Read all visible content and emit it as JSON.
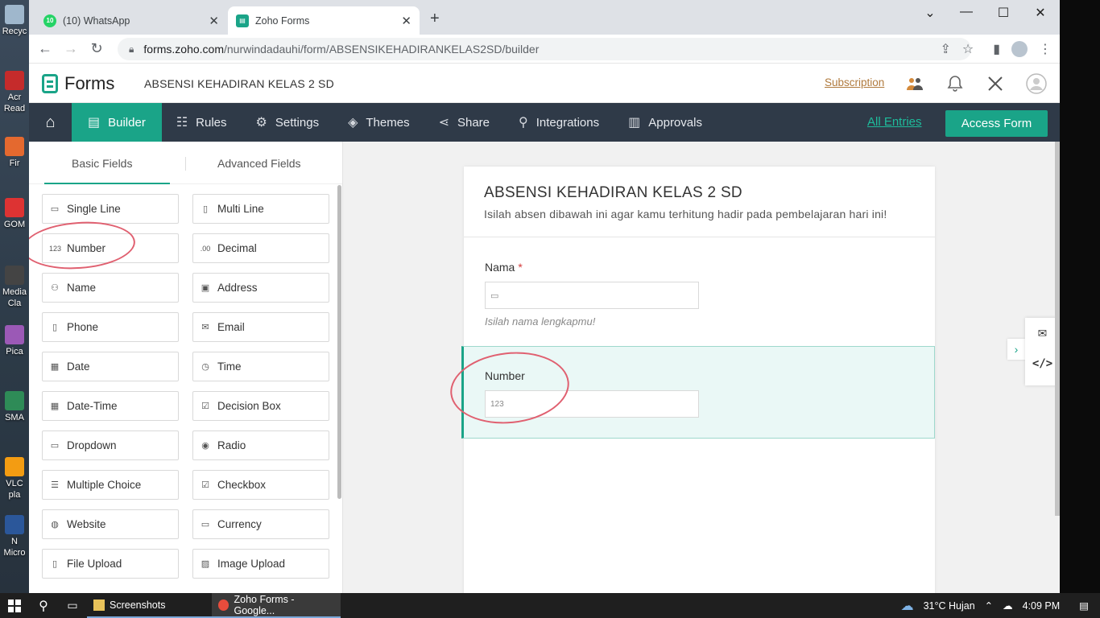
{
  "desktop": {
    "icons": [
      "Recyc",
      "Acr\nRead",
      "Fir",
      "GOM",
      "Media\nCla",
      "Pica",
      "SMA",
      "VLC\npla",
      "N\nMicro"
    ]
  },
  "browser": {
    "tabs": [
      {
        "label": "(10) WhatsApp",
        "badge": "10",
        "color": "#25d366"
      },
      {
        "label": "Zoho Forms",
        "color": "#1aa488"
      }
    ],
    "url_host": "forms.zoho.com",
    "url_path": "/nurwindadauhi/form/ABSENSIKEHADIRANKELAS2SD/builder"
  },
  "header": {
    "app_name": "Forms",
    "form_title": "ABSENSI KEHADIRAN KELAS 2 SD",
    "subscription": "Subscription"
  },
  "nav": {
    "items": [
      {
        "label": "Builder",
        "icon": "builder-icon"
      },
      {
        "label": "Rules",
        "icon": "rules-icon"
      },
      {
        "label": "Settings",
        "icon": "settings-icon"
      },
      {
        "label": "Themes",
        "icon": "themes-icon"
      },
      {
        "label": "Share",
        "icon": "share-icon"
      },
      {
        "label": "Integrations",
        "icon": "integrations-icon"
      },
      {
        "label": "Approvals",
        "icon": "approvals-icon"
      }
    ],
    "all_entries": "All Entries",
    "access_form": "Access Form"
  },
  "panel": {
    "tabs": [
      "Basic Fields",
      "Advanced Fields"
    ],
    "fields": [
      [
        "Single Line",
        "Multi Line"
      ],
      [
        "Number",
        "Decimal"
      ],
      [
        "Name",
        "Address"
      ],
      [
        "Phone",
        "Email"
      ],
      [
        "Date",
        "Time"
      ],
      [
        "Date-Time",
        "Decision Box"
      ],
      [
        "Dropdown",
        "Radio"
      ],
      [
        "Multiple Choice",
        "Checkbox"
      ],
      [
        "Website",
        "Currency"
      ],
      [
        "File Upload",
        "Image Upload"
      ]
    ],
    "field_glyphs": {
      "number": "123",
      "decimal": ".00"
    }
  },
  "form": {
    "title": "ABSENSI KEHADIRAN KELAS 2 SD",
    "description": "Isilah absen dibawah ini agar kamu terhitung hadir pada pembelajaran hari ini!",
    "fields": [
      {
        "label": "Nama",
        "required": "*",
        "hint": "Isilah nama lengkapmu!"
      },
      {
        "label": "Number",
        "placeholder_glyph": "123"
      }
    ]
  },
  "taskbar": {
    "apps": [
      "Screenshots",
      "Zoho Forms - Google..."
    ],
    "weather": "31°C  Hujan",
    "time": "4:09 PM"
  }
}
